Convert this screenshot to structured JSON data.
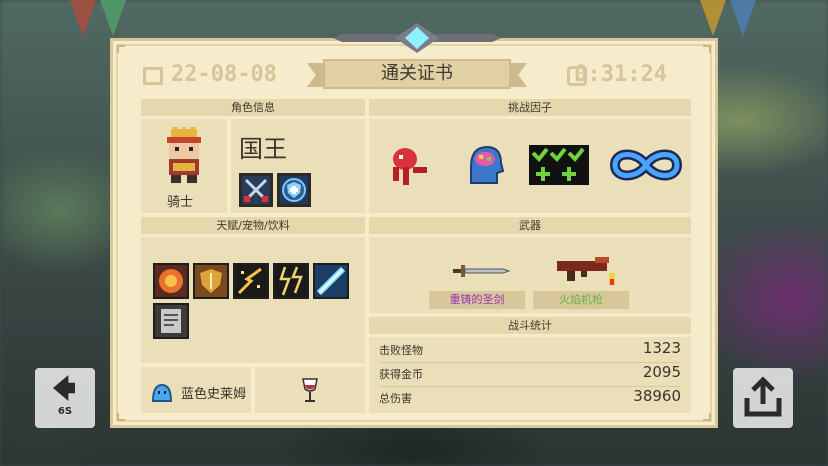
{
  "header": {
    "title": "通关证书",
    "date": "22-08-08",
    "time": "0:31:24"
  },
  "character": {
    "section_label": "角色信息",
    "name": "国王",
    "class": "骑士"
  },
  "challenge": {
    "section_label": "挑战因子"
  },
  "talents": {
    "section_label": "天赋/宠物/饮料",
    "pet_name": "蓝色史莱姆"
  },
  "weapons": {
    "section_label": "武器",
    "primary_name": "重铸的圣剑",
    "secondary_name": "火焰机枪",
    "primary_color": "#9a32b6",
    "secondary_color": "#6ab04c"
  },
  "stats": {
    "section_label": "战斗统计",
    "rows": [
      {
        "label": "击败怪物",
        "value": "1323"
      },
      {
        "label": "获得金币",
        "value": "2095"
      },
      {
        "label": "总伤害",
        "value": "38960"
      }
    ]
  },
  "buttons": {
    "back_count": "6S"
  }
}
